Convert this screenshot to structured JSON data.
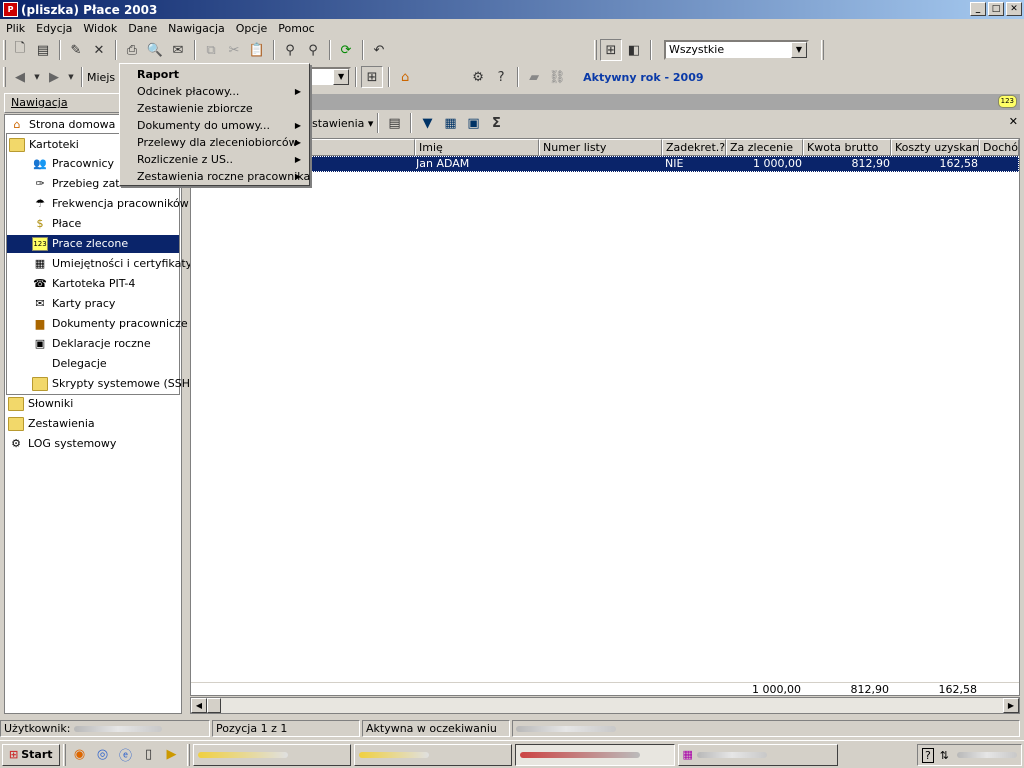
{
  "window": {
    "title": "(pliszka)  Płace 2003",
    "app_icon": "P",
    "min": "_",
    "max": "□",
    "close": "✕"
  },
  "menubar": [
    "Plik",
    "Edycja",
    "Widok",
    "Dane",
    "Nawigacja",
    "Opcje",
    "Pomoc"
  ],
  "toolbar1": {
    "filter_select": "Wszystkie"
  },
  "toolbar2": {
    "location_label": "Miejs",
    "active_year": "Aktywny rok - 2009"
  },
  "nav": {
    "header": "Nawigacja",
    "items": [
      {
        "label": "Strona domowa ap",
        "icon": "home-icon"
      },
      {
        "label": "Kartoteki",
        "icon": "folder-icon"
      },
      {
        "label": "Pracownicy",
        "icon": "employees-icon"
      },
      {
        "label": "Przebieg zatrudnienia",
        "icon": "employment-icon"
      },
      {
        "label": "Frekwencja pracowników",
        "icon": "attendance-icon"
      },
      {
        "label": "Płace",
        "icon": "payroll-icon"
      },
      {
        "label": "Prace zlecone",
        "icon": "contract-icon",
        "badge": "123"
      },
      {
        "label": "Umiejętności i certyfikaty",
        "icon": "certificate-icon"
      },
      {
        "label": "Kartoteka PIT-4",
        "icon": "pit4-icon"
      },
      {
        "label": "Karty pracy",
        "icon": "workcard-icon"
      },
      {
        "label": "Dokumenty pracownicze",
        "icon": "documents-icon"
      },
      {
        "label": "Deklaracje roczne",
        "icon": "declarations-icon"
      },
      {
        "label": "Delegacje",
        "icon": "delegation-icon"
      },
      {
        "label": "Skrypty systemowe (SSH)",
        "icon": "folder-icon"
      },
      {
        "label": "Słowniki",
        "icon": "folder-icon"
      },
      {
        "label": "Zestawienia",
        "icon": "folder-icon"
      },
      {
        "label": "LOG systemowy",
        "icon": "log-icon"
      }
    ]
  },
  "panel": {
    "badge": "123",
    "settings_label": "Ustawienia",
    "close": "✕",
    "sigma": "Σ"
  },
  "grid": {
    "columns": [
      "Imię",
      "Numer listy",
      "Zadekret.?",
      "Za zlecenie",
      "Kwota brutto",
      "Koszty uzyskania",
      "Dochód"
    ],
    "rows": [
      {
        "imie": "Jan ADAM",
        "numer_listy": "",
        "zadekret": "NIE",
        "za_zlecenie": "1 000,00",
        "kwota_brutto": "812,90",
        "koszty": "162,58"
      }
    ],
    "totals": {
      "za_zlecenie": "1 000,00",
      "kwota_brutto": "812,90",
      "koszty": "162,58"
    }
  },
  "context_menu": {
    "items": [
      {
        "label": "Raport",
        "bold": true,
        "submenu": false
      },
      {
        "label": "Odcinek płacowy...",
        "submenu": true
      },
      {
        "label": "Zestawienie zbiorcze",
        "submenu": false
      },
      {
        "label": "Dokumenty do umowy...",
        "submenu": true
      },
      {
        "label": "Przelewy dla zleceniobiorców",
        "submenu": true
      },
      {
        "label": "Rozliczenie z US..",
        "submenu": true
      },
      {
        "label": "Zestawienia roczne pracownika",
        "submenu": true
      }
    ]
  },
  "status": {
    "user_label": "Użytkownik:",
    "position": "Pozycja 1 z 1",
    "state": "Aktywna w oczekiwaniu"
  },
  "taskbar": {
    "start": "Start"
  },
  "colors": {
    "selection": "#0a246a",
    "title_start": "#0a246a",
    "title_end": "#a6caf0",
    "active_year": "#0a3aa8"
  }
}
